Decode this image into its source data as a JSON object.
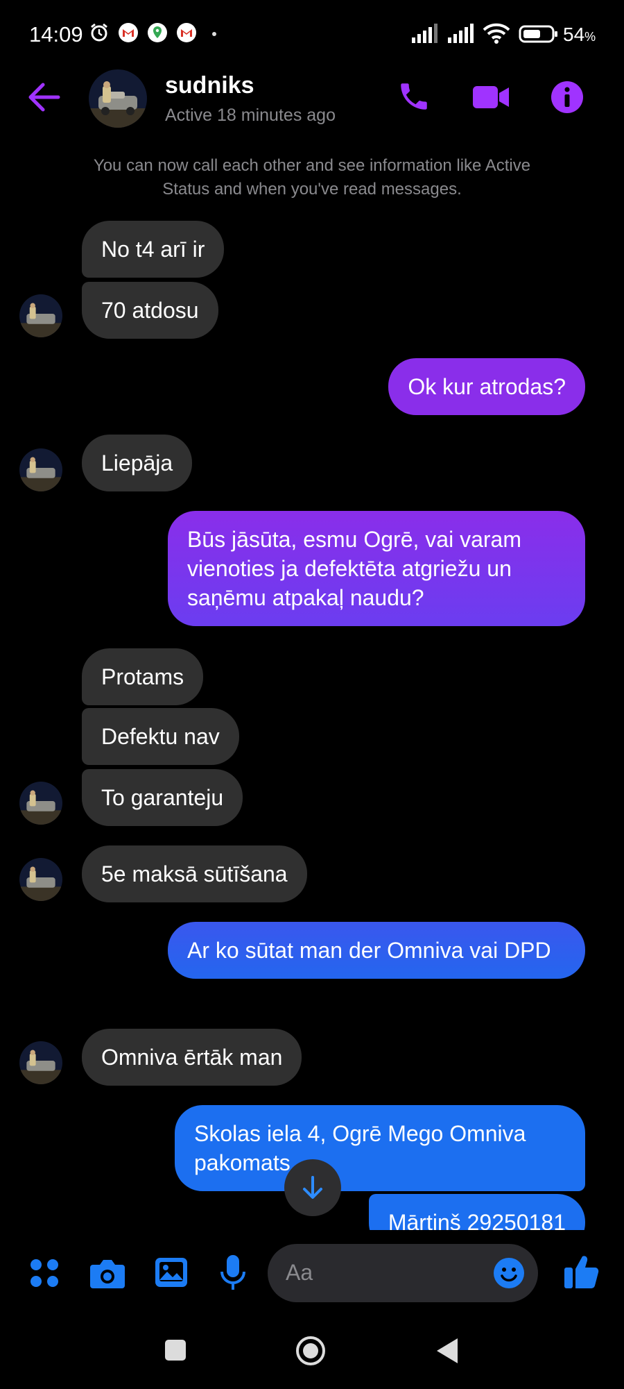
{
  "status_bar": {
    "time": "14:09",
    "battery_percent": "54",
    "battery_suffix": "%",
    "icons": [
      "alarm-icon",
      "gmail-icon",
      "maps-icon",
      "gmail-icon",
      "signal-icon",
      "signal-icon",
      "wifi-icon",
      "battery-icon"
    ]
  },
  "header": {
    "back_icon": "arrow-left-icon",
    "name": "sudniks",
    "status": "Active 18 minutes ago",
    "actions": [
      "phone-icon",
      "video-icon",
      "info-icon"
    ]
  },
  "notice": "You can now call each other and see information like Active Status and when you've read messages.",
  "messages": [
    {
      "from": "them",
      "text": "No t4 arī ir"
    },
    {
      "from": "them",
      "text": "70 atdosu"
    },
    {
      "from": "me",
      "text": "Ok kur atrodas?"
    },
    {
      "from": "them",
      "text": "Liepāja"
    },
    {
      "from": "me",
      "text": "Būs jāsūta, esmu Ogrē, vai varam vienoties ja defektēta atgriežu un saņēmu atpakaļ naudu?"
    },
    {
      "from": "them",
      "text": "Protams"
    },
    {
      "from": "them",
      "text": "Defektu nav"
    },
    {
      "from": "them",
      "text": "To garanteju"
    },
    {
      "from": "them",
      "text": "5e maksā sūtīšana"
    },
    {
      "from": "me",
      "text": "Ar ko sūtat man der Omniva vai DPD"
    },
    {
      "from": "them",
      "text": "Omniva ērtāk man"
    },
    {
      "from": "me",
      "text": "Skolas iela 4, Ogrē Mego Omniva pakomats"
    },
    {
      "from": "me",
      "text": "Mārtinš 29250181"
    }
  ],
  "composer": {
    "placeholder": "Aa",
    "buttons": [
      "apps-icon",
      "camera-icon",
      "gallery-icon",
      "microphone-icon",
      "emoji-icon",
      "thumbs-up-icon"
    ]
  },
  "nav_bar": [
    "recents-icon",
    "home-icon",
    "back-icon"
  ],
  "colors": {
    "accent": "#a033ff",
    "incoming_bubble": "#303030",
    "outgoing_purple": "#8a2eea",
    "outgoing_blue": "#1c6ff0",
    "secondary_text": "#8a8a8e"
  }
}
